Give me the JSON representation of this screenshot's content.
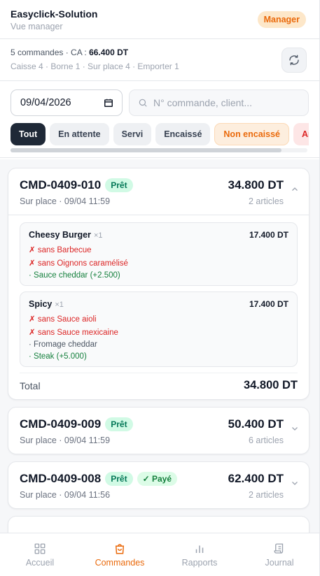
{
  "header": {
    "title": "Easyclick-Solution",
    "subtitle": "Vue manager",
    "role_badge": "Manager"
  },
  "summary": {
    "orders_prefix": "5 commandes · CA :",
    "revenue": "66.400 DT",
    "breakdown": "Caisse 4 · Borne 1 · Sur place 4 · Emporter 1"
  },
  "filters": {
    "date_value": "09/04/2026",
    "search_placeholder": "N° commande, client...",
    "chips": [
      "Tout",
      "En attente",
      "Servi",
      "Encaissé",
      "Non encaissé",
      "Ar"
    ]
  },
  "orders": [
    {
      "id": "CMD-0409-010",
      "status": "Prêt",
      "meta": "Sur place · 09/04 11:59",
      "total": "34.800 DT",
      "count": "2 articles",
      "items": [
        {
          "name": "Cheesy Burger",
          "qty": "×1",
          "price": "17.400 DT",
          "mods": [
            {
              "type": "removed",
              "text": "✗ sans Barbecue"
            },
            {
              "type": "removed",
              "text": "✗ sans Oignons caramélisé"
            },
            {
              "type": "added",
              "text": "· Sauce cheddar (+2.500)"
            }
          ]
        },
        {
          "name": "Spicy",
          "qty": "×1",
          "price": "17.400 DT",
          "mods": [
            {
              "type": "removed",
              "text": "✗ sans Sauce aioli"
            },
            {
              "type": "removed",
              "text": "✗ sans Sauce mexicaine"
            },
            {
              "type": "plain",
              "text": "· Fromage cheddar"
            },
            {
              "type": "added",
              "text": "· Steak (+5.000)"
            }
          ]
        }
      ],
      "total_label": "Total",
      "total_value": "34.800 DT"
    },
    {
      "id": "CMD-0409-009",
      "status": "Prêt",
      "meta": "Sur place · 09/04 11:59",
      "total": "50.400 DT",
      "count": "6 articles"
    },
    {
      "id": "CMD-0409-008",
      "status": "Prêt",
      "paid": "✓ Payé",
      "meta": "Sur place · 09/04 11:56",
      "total": "62.400 DT",
      "count": "2 articles"
    }
  ],
  "nav": {
    "items": [
      "Accueil",
      "Commandes",
      "Rapports",
      "Journal"
    ],
    "active": "Commandes"
  },
  "colors": {
    "accent": "#ea6a0c",
    "dark": "#1f2937",
    "success": "#047857",
    "danger": "#dc2626"
  }
}
